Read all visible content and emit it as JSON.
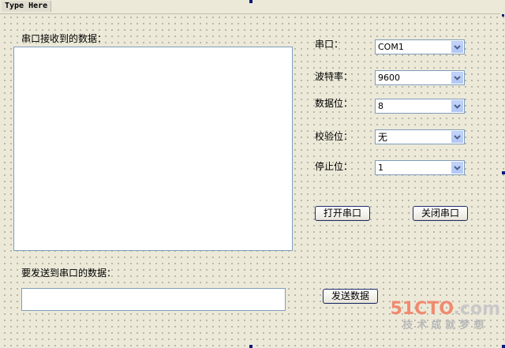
{
  "menu": {
    "item_label": "Type Here"
  },
  "receive": {
    "label": "串口接收到的数据：",
    "content": ""
  },
  "settings": [
    {
      "key": "port",
      "label": "串口：",
      "value": "COM1"
    },
    {
      "key": "baud",
      "label": "波特率：",
      "value": "9600"
    },
    {
      "key": "databits",
      "label": "数据位：",
      "value": "8"
    },
    {
      "key": "parity",
      "label": "校验位：",
      "value": "无"
    },
    {
      "key": "stopbits",
      "label": "停止位：",
      "value": "1"
    }
  ],
  "buttons": {
    "open_label": "打开串口",
    "close_label": "关闭串口",
    "send_label": "发送数据"
  },
  "send": {
    "label": "要发送到串口的数据：",
    "value": ""
  },
  "watermark": {
    "brand": "51CTO",
    "suffix": ".com",
    "tagline": "技术成就梦想"
  },
  "colors": {
    "form_background": "#ece9d8",
    "field_border": "#7f9db9",
    "button_border": "#1e2f6c",
    "combo_arrow": "#4d6185",
    "watermark_brand": "#f08a70"
  }
}
